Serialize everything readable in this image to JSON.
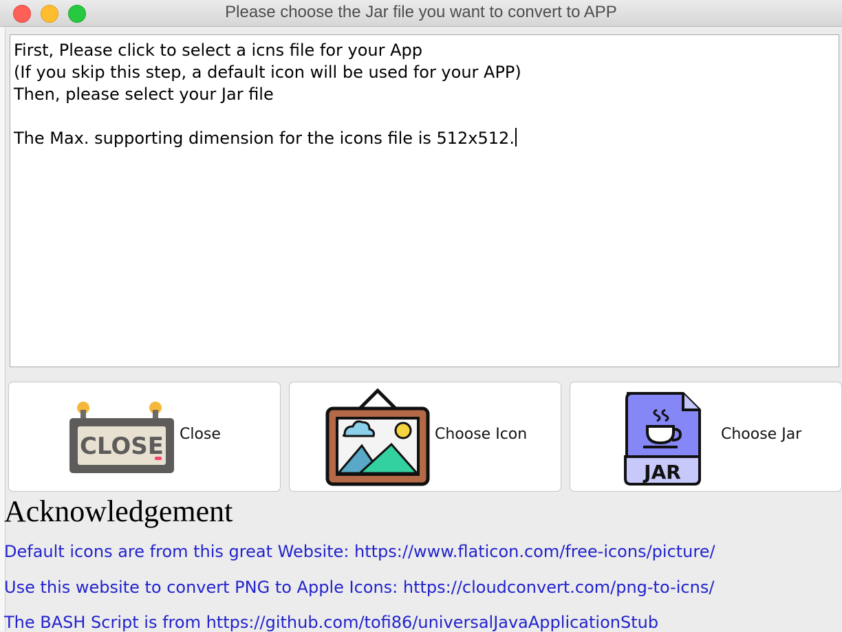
{
  "window": {
    "title": "Please choose the Jar file you want to convert to APP"
  },
  "instructions": {
    "line1": "First, Please click to select a icns file for your App",
    "line2": "(If you skip this step, a default icon will be used for your APP)",
    "line3": "Then, please select your Jar file",
    "line4": "",
    "line5": "The Max. supporting dimension for the icons file is 512x512."
  },
  "buttons": {
    "close": {
      "label": "Close",
      "icon": "close-sign-icon",
      "icon_text": "CLOSE"
    },
    "choose_icon": {
      "label": "Choose Icon",
      "icon": "framed-picture-icon"
    },
    "choose_jar": {
      "label": "Choose Jar",
      "icon": "jar-file-icon",
      "icon_text": "JAR"
    }
  },
  "acknowledgement": {
    "title": "Acknowledgement",
    "links": [
      "Default icons are from this great Website: https://www.flaticon.com/free-icons/picture/",
      "Use this website to convert PNG to Apple Icons: https://cloudconvert.com/png-to-icns/",
      "The BASH Script is from https://github.com/tofi86/universalJavaApplicationStub"
    ]
  },
  "colors": {
    "link": "#2223cc",
    "window_bg": "#ececec",
    "close_red": "#fe5f57",
    "minimize_yellow": "#febc2e",
    "zoom_green": "#28c840"
  }
}
